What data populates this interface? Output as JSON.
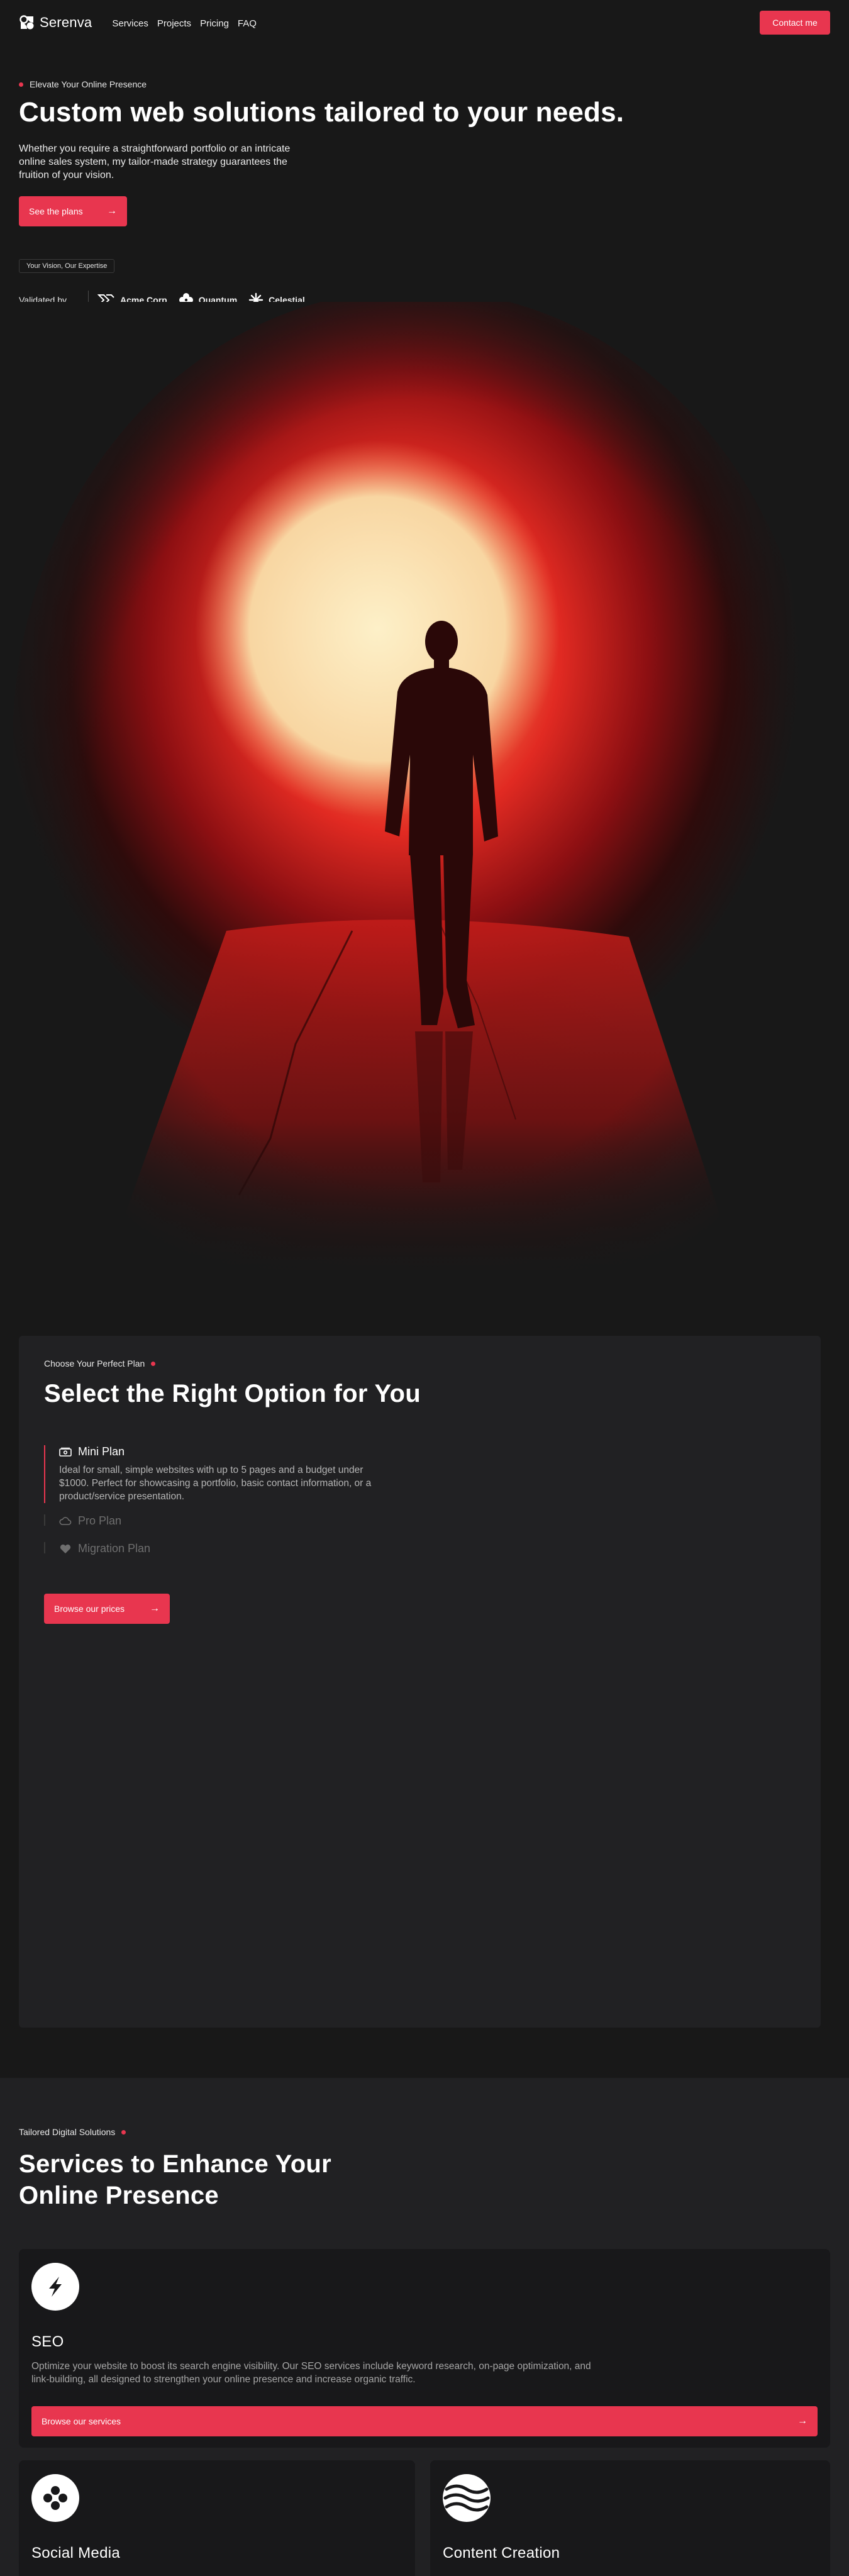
{
  "nav": {
    "brand": "Serenva",
    "links": [
      "Services",
      "Projects",
      "Pricing",
      "FAQ"
    ],
    "cta": "Contact me"
  },
  "hero": {
    "eyebrow": "Elevate Your Online Presence",
    "title": "Custom web solutions tailored to your needs.",
    "subtitle": "Whether you require a straightforward portfolio or an intricate online sales system, my tailor-made strategy guarantees the fruition of your vision.",
    "cta": "See the plans",
    "badge": "Your Vision, Our Expertise",
    "validated_label": "Validated by",
    "partners": [
      {
        "name": "Acme Corp",
        "icon": "double-chevron-icon"
      },
      {
        "name": "Quantum",
        "icon": "quatrefoil-icon"
      },
      {
        "name": "Celestial",
        "icon": "starburst-icon"
      }
    ]
  },
  "plans": {
    "eyebrow": "Choose Your Perfect Plan",
    "title": "Select the Right Option for You",
    "items": [
      {
        "name": "Mini Plan",
        "icon": "money-icon",
        "active": true,
        "description": "Ideal for small, simple websites with up to 5 pages and a budget under $1000. Perfect for showcasing a portfolio, basic contact information, or a product/service presentation."
      },
      {
        "name": "Pro Plan",
        "icon": "cloud-icon",
        "active": false,
        "description": ""
      },
      {
        "name": "Migration Plan",
        "icon": "heart-icon",
        "active": false,
        "description": ""
      }
    ],
    "cta": "Browse our prices"
  },
  "services": {
    "eyebrow": "Tailored Digital Solutions",
    "title": "Services to Enhance Your Online Presence",
    "cards": [
      {
        "name": "SEO",
        "icon": "lightning-icon",
        "description": "Optimize your website to boost its search engine visibility. Our SEO services include keyword research, on-page optimization, and link-building, all designed to strengthen your online presence and increase organic traffic.",
        "cta": "Browse our services"
      },
      {
        "name": "Social Media",
        "icon": "four-dots-icon"
      },
      {
        "name": "Content Creation",
        "icon": "waves-icon"
      }
    ]
  },
  "colors": {
    "accent": "#e8364f",
    "background": "#181818",
    "card": "#212123"
  }
}
